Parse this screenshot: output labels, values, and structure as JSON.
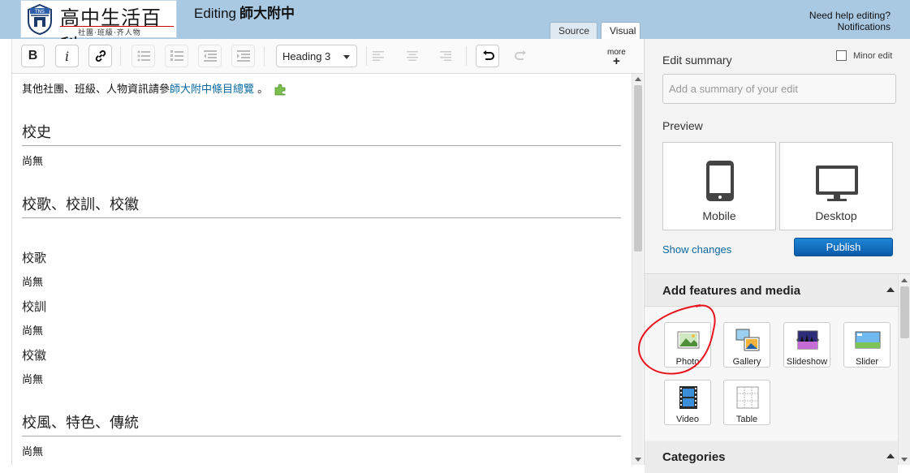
{
  "header": {
    "logo": {
      "badge": "TNS",
      "title": "高中生活百科",
      "tagline": "社團·班級·齐人物"
    },
    "editing_prefix": "Editing",
    "page_name": "師大附中",
    "help_link": "Need help editing?",
    "notifications_link": "Notifications",
    "tabs": [
      {
        "label": "Source"
      },
      {
        "label": "Visual"
      }
    ]
  },
  "toolbar": {
    "bold_label": "B",
    "italic_label": "i",
    "heading_select": "Heading 3",
    "more_label": "more",
    "more_plus": "+"
  },
  "content": {
    "intro_text": "其他社團、班級、人物資訊請參",
    "intro_link": "師大附中條目總覽",
    "intro_end": "。",
    "sections": [
      {
        "heading": "校史",
        "text": "尚無"
      },
      {
        "heading": "校歌、校訓、校徽"
      },
      {
        "heading": "校風、特色、傳統",
        "text": "尚無"
      }
    ],
    "subsections": [
      {
        "heading": "校歌",
        "text": "尚無"
      },
      {
        "heading": "校訓",
        "text": "尚無"
      },
      {
        "heading": "校徽",
        "text": "尚無"
      }
    ]
  },
  "sidebar": {
    "edit_summary_label": "Edit summary",
    "minor_edit_label": "Minor edit",
    "summary_placeholder": "Add a summary of your edit",
    "preview_label": "Preview",
    "preview_mobile": "Mobile",
    "preview_desktop": "Desktop",
    "show_changes": "Show changes",
    "publish": "Publish",
    "features_title": "Add features and media",
    "media_buttons": [
      {
        "label": "Photo"
      },
      {
        "label": "Gallery"
      },
      {
        "label": "Slideshow"
      },
      {
        "label": "Slider"
      },
      {
        "label": "Video"
      },
      {
        "label": "Table"
      }
    ],
    "categories_title": "Categories"
  },
  "colors": {
    "header_bg": "#a9c9e3",
    "link": "#0b6aa2",
    "publish_bg": "#1177cc",
    "annotation_red": "#e8141d"
  }
}
